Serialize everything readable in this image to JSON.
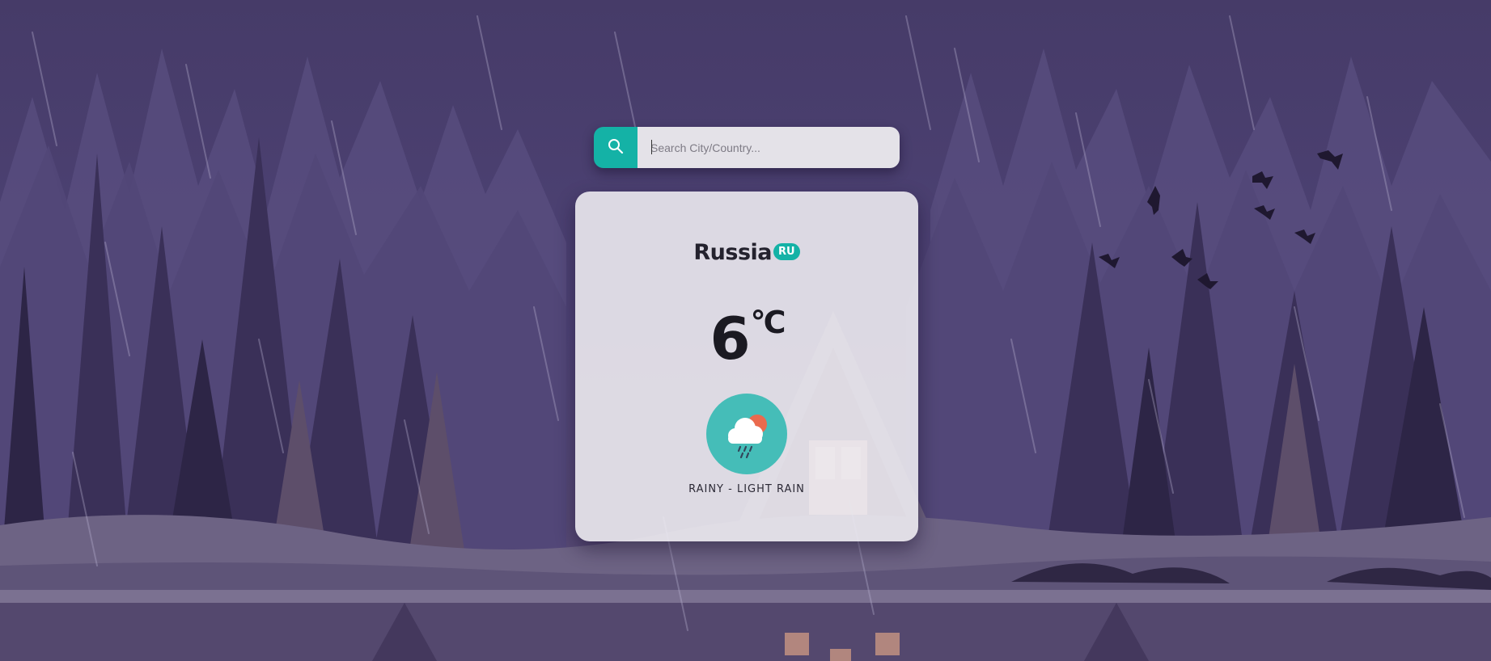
{
  "search": {
    "placeholder": "Search City/Country...",
    "value": "",
    "icon": "search-icon"
  },
  "weather": {
    "country_name": "Russia",
    "country_code": "RU",
    "temperature": "6",
    "unit": "°C",
    "condition_icon": "rain-cloud-sun-icon",
    "description": "RAINY - LIGHT RAIN"
  },
  "colors": {
    "accent": "#14b2a6",
    "icon_background": "#45bdb8",
    "card_background": "#ebe9ef",
    "background": "#4b4170"
  }
}
